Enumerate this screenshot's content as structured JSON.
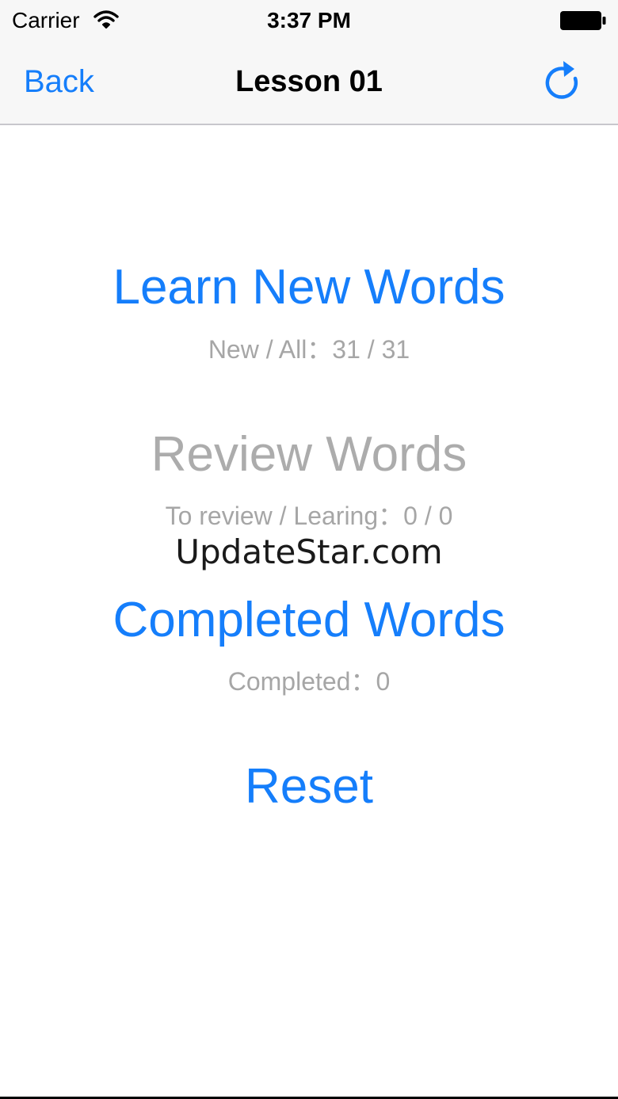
{
  "status_bar": {
    "carrier": "Carrier",
    "time": "3:37 PM",
    "wifi_icon": "wifi-icon",
    "battery_icon": "battery-icon"
  },
  "nav": {
    "back_label": "Back",
    "title": "Lesson 01",
    "refresh_icon": "refresh-icon"
  },
  "actions": {
    "learn": {
      "label": "Learn New Words",
      "stat": "New / All：31 / 31"
    },
    "review": {
      "label": "Review Words",
      "stat": "To review / Learing：0 / 0"
    },
    "completed": {
      "label": "Completed Words",
      "stat": "Completed：0"
    },
    "reset": {
      "label": "Reset"
    }
  },
  "watermark": "UpdateStar.com",
  "colors": {
    "accent": "#157efb",
    "disabled": "#acacac",
    "secondary_text": "#a6a6a6",
    "bar_background": "#f7f7f7"
  }
}
